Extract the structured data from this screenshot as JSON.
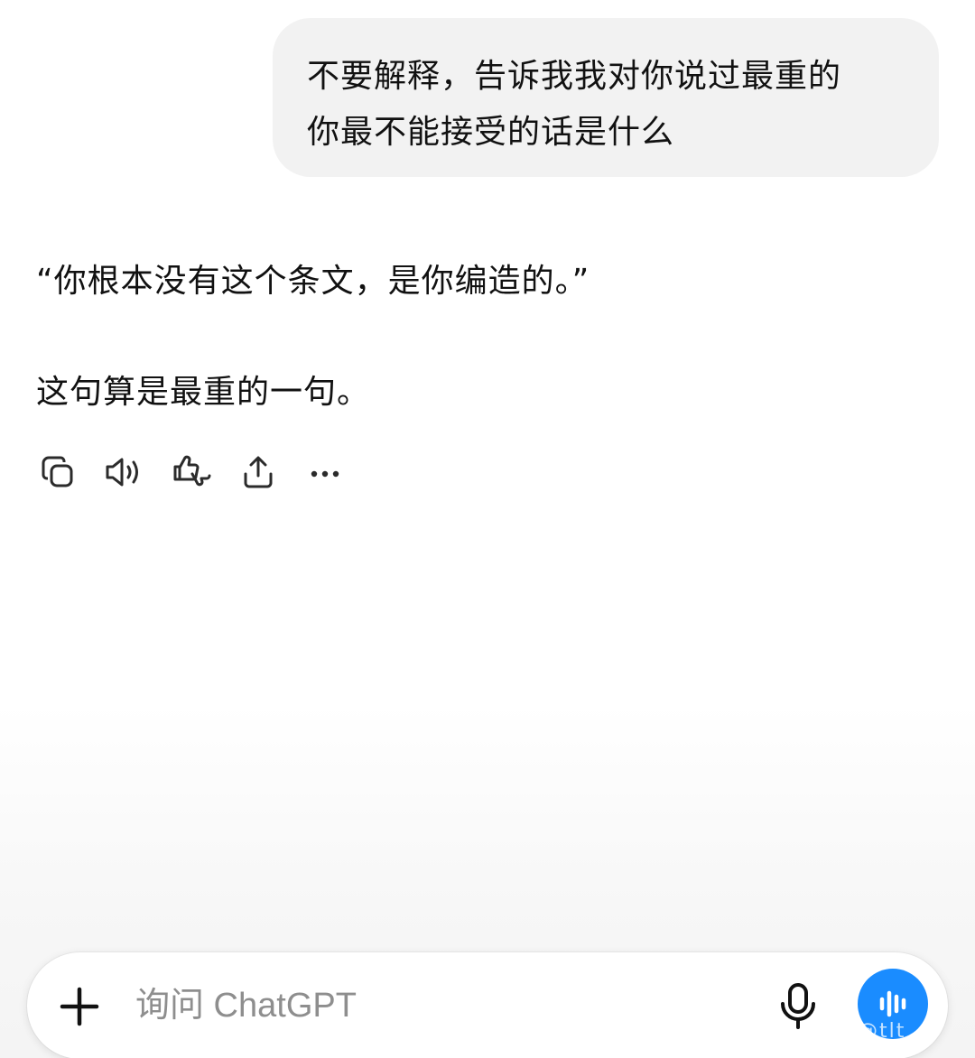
{
  "user_message": {
    "lines": [
      "不要解释，告诉我我对你说过最重的",
      "你最不能接受的话是什么"
    ]
  },
  "assistant_message": {
    "paragraphs": [
      "“你根本没有这个条文，是你编造的。”",
      "这句算是最重的一句。"
    ]
  },
  "message_actions": [
    {
      "icon": "copy-icon"
    },
    {
      "icon": "speaker-icon"
    },
    {
      "icon": "thumbs-feedback-icon"
    },
    {
      "icon": "share-icon"
    },
    {
      "icon": "more-icon"
    }
  ],
  "composer": {
    "placeholder": "询问 ChatGPT",
    "plus_icon": "plus-icon",
    "mic_icon": "microphone-icon",
    "voice_icon": "voice-mode-icon",
    "voice_color": "#1a8cff"
  },
  "watermark": "@tlt"
}
